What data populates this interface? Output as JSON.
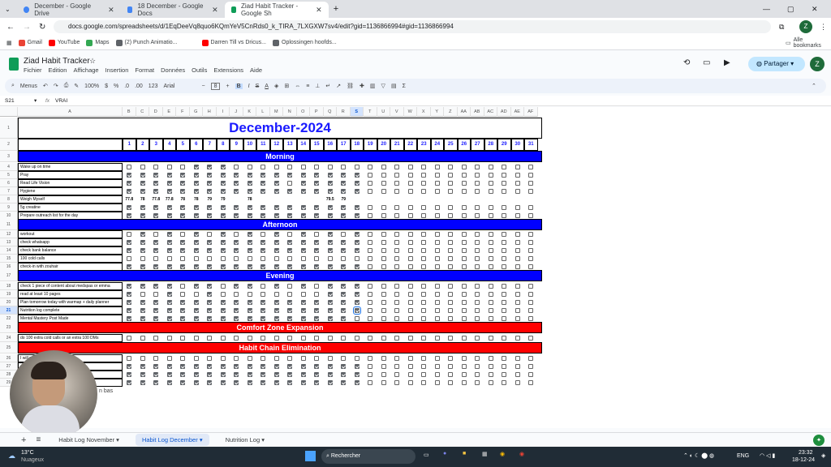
{
  "browser": {
    "tabs": [
      {
        "label": "December - Google Drive",
        "color": "#4285f4"
      },
      {
        "label": "18 December - Google Docs",
        "color": "#4285f4"
      },
      {
        "label": "Ziad Habit Tracker - Google Sh",
        "color": "#0f9d58",
        "active": true
      }
    ],
    "url": "docs.google.com/spreadsheets/d/1EqDeeVq8quo6KQmYeV5CnRds0_k_TIRA_7LXGXW7sv4/edit?gid=1136866994#gid=1136866994",
    "bookmarks": [
      "Gmail",
      "YouTube",
      "Maps",
      "(2) Punch Animatio...",
      "Darren Till vs Dricus...",
      "Oplossingen hoofds..."
    ],
    "all_bookmarks": "Alle bookmarks"
  },
  "sheets": {
    "title": "Ziad Habit Tracker",
    "menus": [
      "Fichier",
      "Edition",
      "Affichage",
      "Insertion",
      "Format",
      "Données",
      "Outils",
      "Extensions",
      "Aide"
    ],
    "share_label": "Partager",
    "avatar_letter": "Z",
    "toolbar": {
      "menus": "Menus",
      "zoom": "100%",
      "currency": "$",
      "percent": "%",
      "decimals": ".0",
      "decimals2": ".00",
      "format123": "123",
      "font": "Arial",
      "font_size": "8"
    },
    "cell_ref": "S21",
    "formula": "VRAI"
  },
  "spreadsheet": {
    "title": "December-2024",
    "columns": [
      "A",
      "B",
      "C",
      "D",
      "E",
      "F",
      "G",
      "H",
      "I",
      "J",
      "K",
      "L",
      "M",
      "N",
      "O",
      "P",
      "Q",
      "R",
      "S",
      "T",
      "U",
      "V",
      "W",
      "X",
      "Y",
      "Z",
      "AA",
      "AB",
      "AC",
      "AD",
      "AE",
      "AF"
    ],
    "days": [
      "1",
      "2",
      "3",
      "4",
      "5",
      "6",
      "7",
      "8",
      "9",
      "10",
      "11",
      "12",
      "13",
      "14",
      "15",
      "16",
      "17",
      "18",
      "19",
      "20",
      "21",
      "22",
      "23",
      "24",
      "25",
      "26",
      "27",
      "28",
      "29",
      "30",
      "31"
    ],
    "sections": [
      {
        "name": "Morning",
        "color": "#0000ff",
        "row": "3",
        "habits": [
          {
            "row": "4",
            "label": "Wake up on time",
            "done": [
              0,
              0,
              0,
              0,
              0,
              1,
              1,
              1,
              0,
              0,
              0,
              0,
              0,
              0,
              0,
              0,
              0,
              0
            ]
          },
          {
            "row": "5",
            "label": "Pray",
            "done": [
              1,
              1,
              1,
              1,
              1,
              1,
              1,
              1,
              1,
              1,
              1,
              1,
              1,
              1,
              1,
              1,
              1,
              1
            ]
          },
          {
            "row": "6",
            "label": "Read Life Vision",
            "done": [
              1,
              1,
              1,
              1,
              1,
              1,
              1,
              1,
              1,
              1,
              1,
              1,
              0,
              1,
              1,
              1,
              1,
              1
            ]
          },
          {
            "row": "7",
            "label": "Hygiene",
            "done": [
              1,
              1,
              1,
              1,
              1,
              1,
              1,
              1,
              1,
              1,
              1,
              1,
              1,
              1,
              1,
              1,
              1,
              1
            ]
          },
          {
            "row": "8",
            "label": "Weigh Myself",
            "weights": [
              "77.8",
              "78",
              "77.8",
              "77.8",
              "78",
              "78",
              "79",
              "79",
              "",
              "78",
              "",
              "",
              "",
              "",
              "",
              "79.5",
              "79",
              ""
            ]
          },
          {
            "row": "9",
            "label": "5g creatine",
            "done": [
              1,
              1,
              1,
              1,
              1,
              1,
              1,
              1,
              1,
              1,
              1,
              1,
              1,
              1,
              1,
              1,
              1,
              1
            ]
          },
          {
            "row": "10",
            "label": "Prepare outreach list for the day",
            "done": [
              1,
              1,
              1,
              1,
              1,
              1,
              1,
              1,
              1,
              1,
              1,
              1,
              1,
              1,
              1,
              1,
              1,
              1
            ]
          }
        ]
      },
      {
        "name": "Afternoon",
        "color": "#0000ff",
        "row": "11",
        "habits": [
          {
            "row": "12",
            "label": "workout",
            "done": [
              0,
              1,
              0,
              1,
              0,
              1,
              0,
              1,
              0,
              1,
              0,
              1,
              0,
              1,
              0,
              1,
              0,
              1
            ]
          },
          {
            "row": "13",
            "label": "check whatsapp",
            "done": [
              1,
              1,
              1,
              1,
              1,
              1,
              1,
              1,
              1,
              1,
              1,
              1,
              1,
              1,
              1,
              1,
              1,
              1
            ]
          },
          {
            "row": "14",
            "label": "check bank balance",
            "done": [
              1,
              1,
              1,
              1,
              1,
              1,
              1,
              1,
              1,
              1,
              1,
              1,
              1,
              1,
              1,
              1,
              1,
              1
            ]
          },
          {
            "row": "15",
            "label": "100 cold calls",
            "done": [
              0,
              0,
              0,
              0,
              0,
              0,
              0,
              0,
              0,
              0,
              0,
              0,
              0,
              0,
              0,
              0,
              0,
              0
            ]
          },
          {
            "row": "16",
            "label": "check-in with zouhair",
            "done": [
              1,
              1,
              1,
              1,
              1,
              1,
              1,
              1,
              1,
              1,
              1,
              1,
              1,
              1,
              1,
              1,
              1,
              1
            ]
          }
        ]
      },
      {
        "name": "Evening",
        "color": "#0000ff",
        "row": "17",
        "habits": [
          {
            "row": "18",
            "label": "check 1 piece of content about medspas or emma",
            "done": [
              1,
              1,
              1,
              1,
              0,
              1,
              1,
              0,
              1,
              1,
              0,
              1,
              0,
              1,
              0,
              1,
              1,
              1
            ]
          },
          {
            "row": "19",
            "label": "read at least 10 pages",
            "done": [
              1,
              0,
              0,
              1,
              0,
              0,
              1,
              0,
              0,
              0,
              0,
              0,
              0,
              0,
              0,
              1,
              1,
              1
            ]
          },
          {
            "row": "20",
            "label": "Plan tomorrow today with warmap + daily planner",
            "done": [
              1,
              1,
              1,
              1,
              1,
              1,
              1,
              1,
              1,
              1,
              1,
              1,
              1,
              1,
              1,
              1,
              1,
              1
            ]
          },
          {
            "row": "21",
            "label": "Nutrition log complete",
            "done": [
              1,
              1,
              1,
              1,
              1,
              1,
              1,
              1,
              1,
              1,
              1,
              1,
              1,
              1,
              1,
              1,
              1,
              1
            ]
          },
          {
            "row": "22",
            "label": "Mental Mastery Post Made",
            "done": [
              1,
              1,
              1,
              1,
              1,
              1,
              1,
              1,
              1,
              1,
              1,
              1,
              1,
              1,
              1,
              1,
              1,
              0
            ]
          }
        ]
      },
      {
        "name": "Comfort Zone Expansion",
        "color": "#ff0000",
        "row": "23",
        "habits": [
          {
            "row": "24",
            "label": "do 100 extra cold calls or an extra 100 DMs",
            "done": [
              0,
              0,
              0,
              0,
              0,
              0,
              0,
              0,
              0,
              0,
              0,
              0,
              0,
              0,
              0,
              0,
              0,
              0
            ]
          }
        ]
      },
      {
        "name": "Habit Chain Elimination",
        "color": "#ff0000",
        "row": "25",
        "habits": [
          {
            "row": "26",
            "label": "I will not ... ep",
            "done": [
              0,
              0,
              0,
              0,
              0,
              0,
              0,
              0,
              0,
              0,
              0,
              0,
              0,
              0,
              0,
              0,
              0,
              0
            ]
          },
          {
            "row": "27",
            "label": "",
            "done": [
              1,
              1,
              1,
              1,
              1,
              1,
              1,
              1,
              1,
              1,
              1,
              1,
              1,
              1,
              1,
              1,
              1,
              1
            ]
          },
          {
            "row": "28",
            "label": "",
            "done": [
              1,
              1,
              1,
              1,
              1,
              1,
              1,
              1,
              1,
              1,
              1,
              1,
              1,
              1,
              1,
              1,
              1,
              1
            ]
          },
          {
            "row": "29",
            "label": "",
            "done": [
              1,
              1,
              1,
              1,
              1,
              1,
              1,
              1,
              1,
              1,
              1,
              1,
              1,
              1,
              1,
              1,
              1,
              1
            ]
          }
        ]
      }
    ],
    "overflow_text": "n bas"
  },
  "sheet_tabs": [
    "Habit Log November",
    "Habit Log December",
    "Nutrition Log"
  ],
  "taskbar": {
    "weather_temp": "13°C",
    "weather_desc": "Nuageux",
    "search": "Rechercher",
    "lang": "ENG",
    "time": "23:32",
    "date": "18-12-24"
  }
}
